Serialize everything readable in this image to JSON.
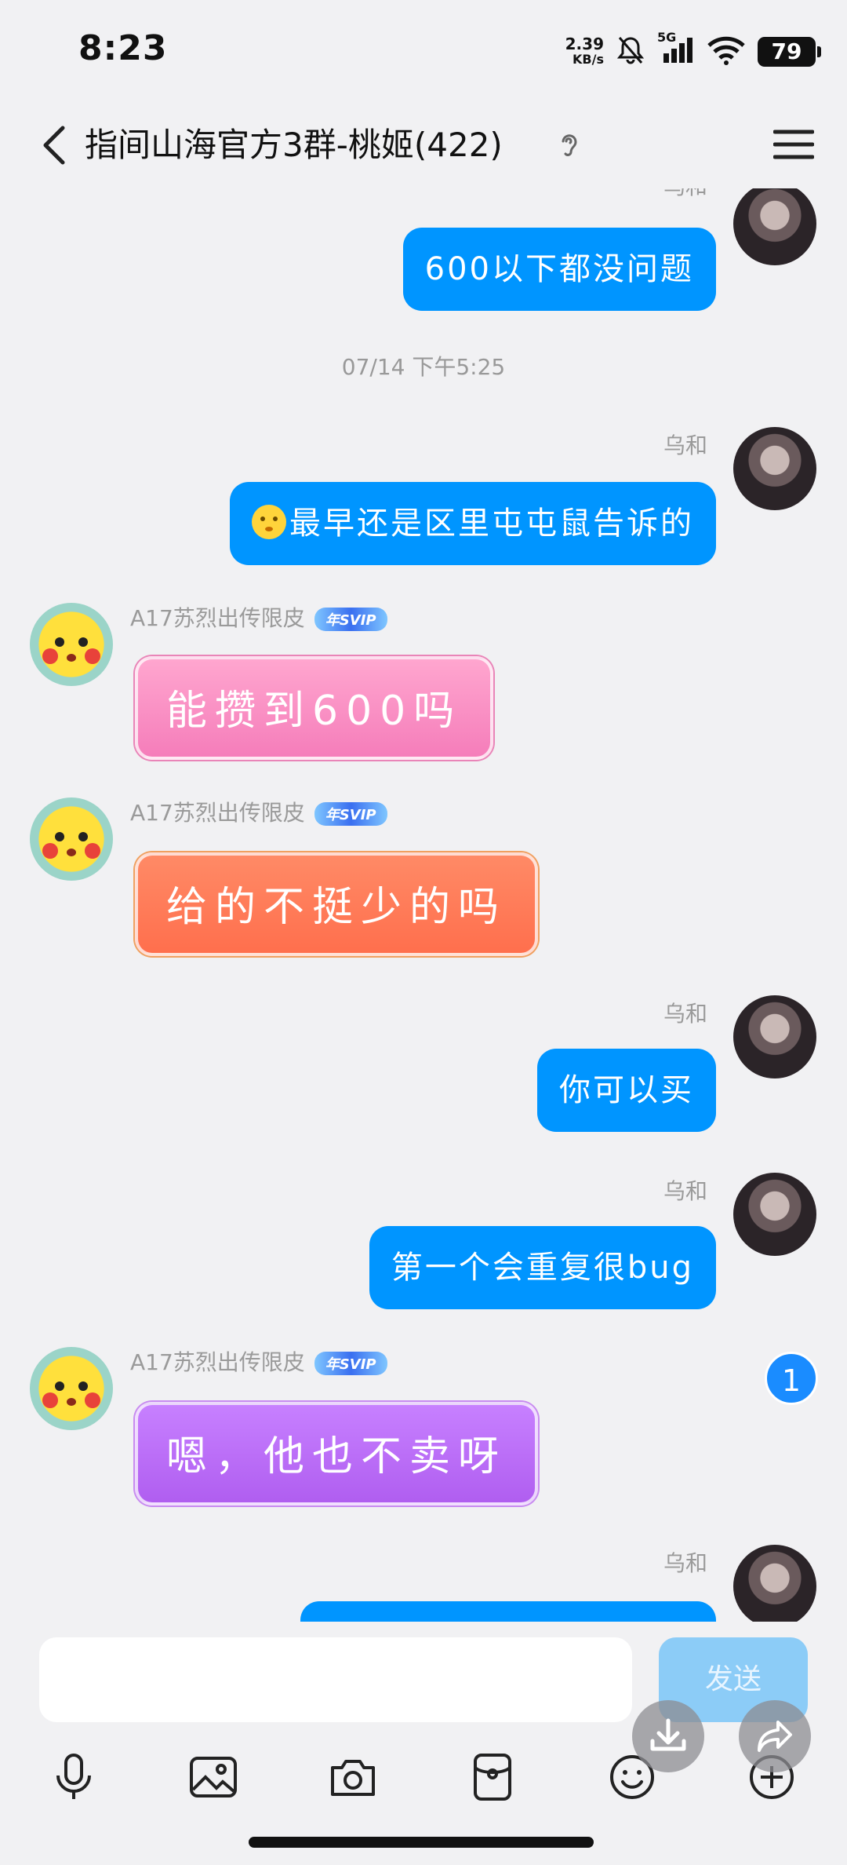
{
  "status_bar": {
    "time": "8:23",
    "net_speed_value": "2.39",
    "net_speed_unit": "KB/s",
    "network": "5G",
    "battery": "79"
  },
  "header": {
    "title": "指间山海官方3群-桃姬(422)"
  },
  "chat": {
    "messages": [
      {
        "sender": "乌和",
        "text": "600以下都没问题",
        "side": "right"
      },
      {
        "timestamp": "07/14 下午5:25"
      },
      {
        "sender": "乌和",
        "text": "最早还是区里屯屯鼠告诉的",
        "side": "right",
        "leading_emoji": "smiley-emoji"
      },
      {
        "sender": "A17苏烈出传限皮",
        "badge": "年SVIP",
        "text": "能攒到600吗",
        "side": "left",
        "bubble_color": "#f57dba"
      },
      {
        "sender": "A17苏烈出传限皮",
        "badge": "年SVIP",
        "text": "给的不挺少的吗",
        "side": "left",
        "bubble_color": "#ff6f4d"
      },
      {
        "sender": "乌和",
        "text": "你可以买",
        "side": "right"
      },
      {
        "sender": "乌和",
        "text": "第一个会重复很bug",
        "side": "right"
      },
      {
        "sender": "A17苏烈出传限皮",
        "badge": "年SVIP",
        "text": "嗯，他也不卖呀",
        "side": "left",
        "bubble_color": "#b05ef0"
      },
      {
        "sender": "乌和",
        "text": "",
        "side": "right"
      }
    ],
    "unread_count": "1"
  },
  "input": {
    "placeholder": "",
    "value": "",
    "send_label": "发送"
  },
  "toolbar": {
    "icons": [
      "microphone-icon",
      "image-icon",
      "camera-icon",
      "red-packet-icon",
      "emoji-icon",
      "plus-icon"
    ]
  },
  "colors": {
    "accent": "#0095ff",
    "background": "#f1f1f3"
  }
}
